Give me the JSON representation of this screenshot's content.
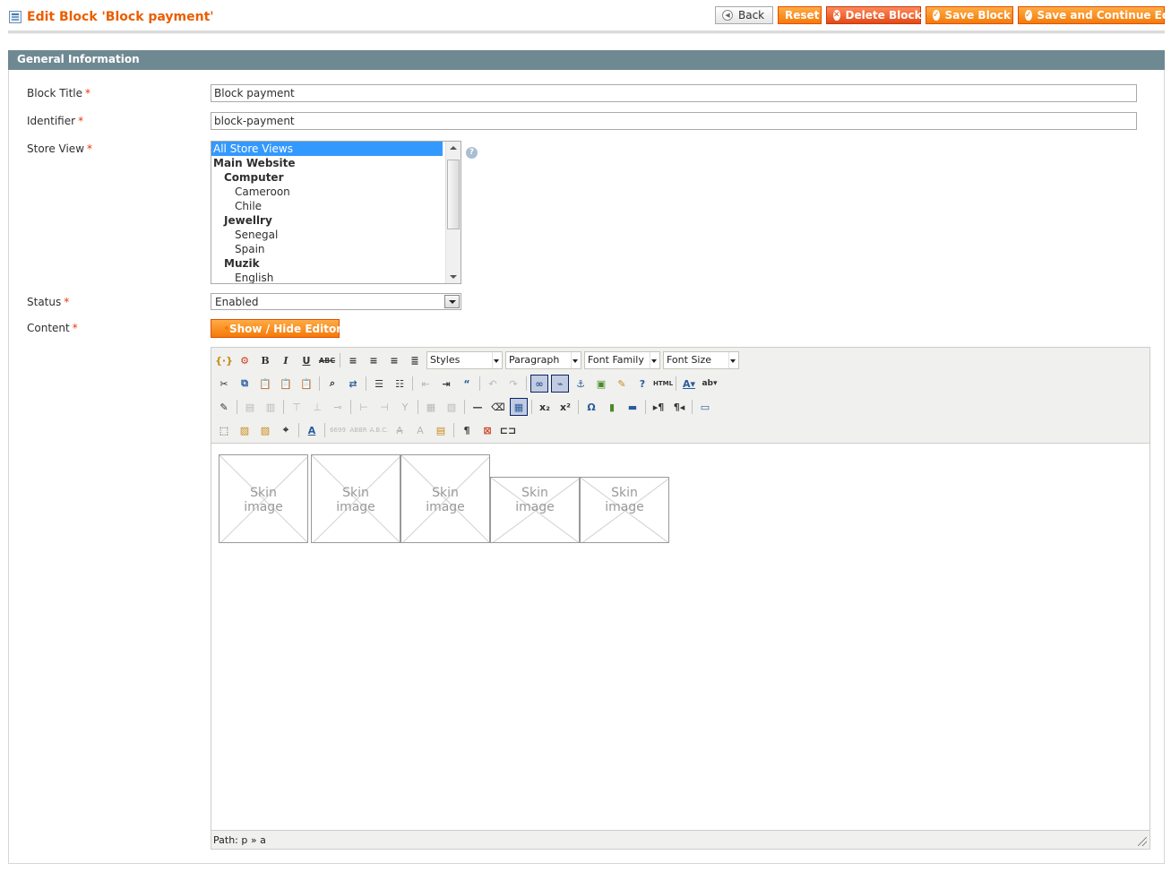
{
  "header": {
    "title": "Edit Block 'Block payment'",
    "buttons": {
      "back": "Back",
      "reset": "Reset",
      "delete": "Delete Block",
      "save": "Save Block",
      "save_continue": "Save and Continue Edit"
    }
  },
  "fieldset": {
    "title": "General Information"
  },
  "form": {
    "block_title_label": "Block Title",
    "block_title_value": "Block payment",
    "identifier_label": "Identifier",
    "identifier_value": "block-payment",
    "store_view_label": "Store View",
    "store_views": [
      {
        "label": "All Store Views",
        "level": "g0",
        "selected": true
      },
      {
        "label": "Main Website",
        "level": "g1"
      },
      {
        "label": "Computer",
        "level": "g2"
      },
      {
        "label": "Cameroon",
        "level": "g3"
      },
      {
        "label": "Chile",
        "level": "g3"
      },
      {
        "label": "Jewellry",
        "level": "g2"
      },
      {
        "label": "Senegal",
        "level": "g3"
      },
      {
        "label": "Spain",
        "level": "g3"
      },
      {
        "label": "Muzik",
        "level": "g2"
      },
      {
        "label": "English",
        "level": "g3"
      }
    ],
    "status_label": "Status",
    "status_value": "Enabled",
    "content_label": "Content",
    "required_mark": "*",
    "show_hide_editor": "Show / Hide Editor"
  },
  "editor": {
    "styles_select": "Styles",
    "format_select": "Paragraph",
    "font_family_select": "Font Family",
    "font_size_select": "Font Size",
    "skin_image_text": [
      "Skin",
      "image"
    ],
    "path_label": "Path: p » a"
  },
  "colors": {
    "accent": "#eb5e00",
    "button_orange": "#f47a0a",
    "fieldset_header": "#6f8992",
    "selected_option": "#3399ff"
  }
}
